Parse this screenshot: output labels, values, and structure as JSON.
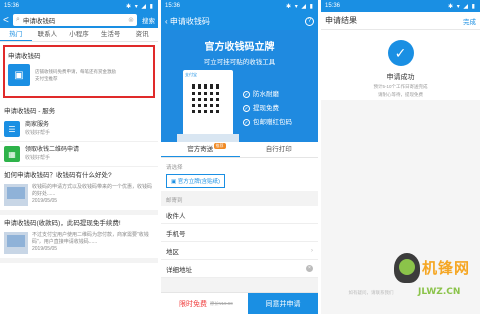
{
  "status": {
    "time1": "15:36",
    "time2": "15:36",
    "time3": "15:36",
    "icons": "✱ ▾ ◢ ▮"
  },
  "p1": {
    "back": "<",
    "search_value": "申请收钱码",
    "search_button": "搜索",
    "tabs": [
      "热门",
      "联系人",
      "小程序",
      "生活号",
      "资讯"
    ],
    "top_card_title": "申请收钱码",
    "top_card_desc1": "店铺收钱码免费申请，每笔还有赏金激励",
    "top_card_desc2": "支付宝推荐",
    "services_title_hl": "申请收钱码",
    "services_title_rest": " - 服务",
    "services": [
      {
        "title": "商家服务",
        "sub": "收钱好帮手",
        "icon_color": "#1a8fe3"
      },
      {
        "title": "领取收钱二维码申请",
        "sub": "收钱好帮手",
        "icon_color": "#2eb34a"
      }
    ],
    "q1": "如何申请收钱码？收钱码有什么好处?",
    "q1_desc": "收钱码的申请方式以及收钱码带来的一个优惠，收钱码的好处......",
    "q1_date": "2019/05/05",
    "q2": "申请收钱码(收款码)，此码提现免手续费!",
    "q2_desc": "不过支付宝用户使用二维码为您付款，商家需要\"收钱码\"，用户直接申请收钱码......",
    "q2_date": "2019/05/05"
  },
  "p2": {
    "title": "申请收钱码",
    "help": "?",
    "banner_h1": "官方收钱码立牌",
    "banner_h2": "可立可挂可贴的收钱工具",
    "stand_logo": "支付宝",
    "features": [
      "防水耐磨",
      "提现免费",
      "包邮赠红包码"
    ],
    "tab_left": "官方寄送",
    "tab_badge": "推荐",
    "tab_right": "自行打印",
    "choose_label": "请选择",
    "choice": "官方立牌(含贴纸)",
    "address_label": "邮寄到",
    "fields": [
      "收件人",
      "手机号",
      "地区",
      "详细地址"
    ],
    "price_label": "限时免费",
    "price_old": "原价¥19.90",
    "apply_button": "同意并申请"
  },
  "p3": {
    "title": "申请结果",
    "done": "完成",
    "check": "✓",
    "ok": "申请成功",
    "note1": "预计5-10个工作日寄送完成",
    "note2": "请耐心等待，提现免费",
    "footer": "如有疑问，请联系我们",
    "watermark_cn": "机锋网",
    "watermark_url": "JLWZ.CN"
  },
  "colors": {
    "accent": "#1a8fe3",
    "highlight_border": "#e02a2a",
    "price": "#f03c3c"
  }
}
